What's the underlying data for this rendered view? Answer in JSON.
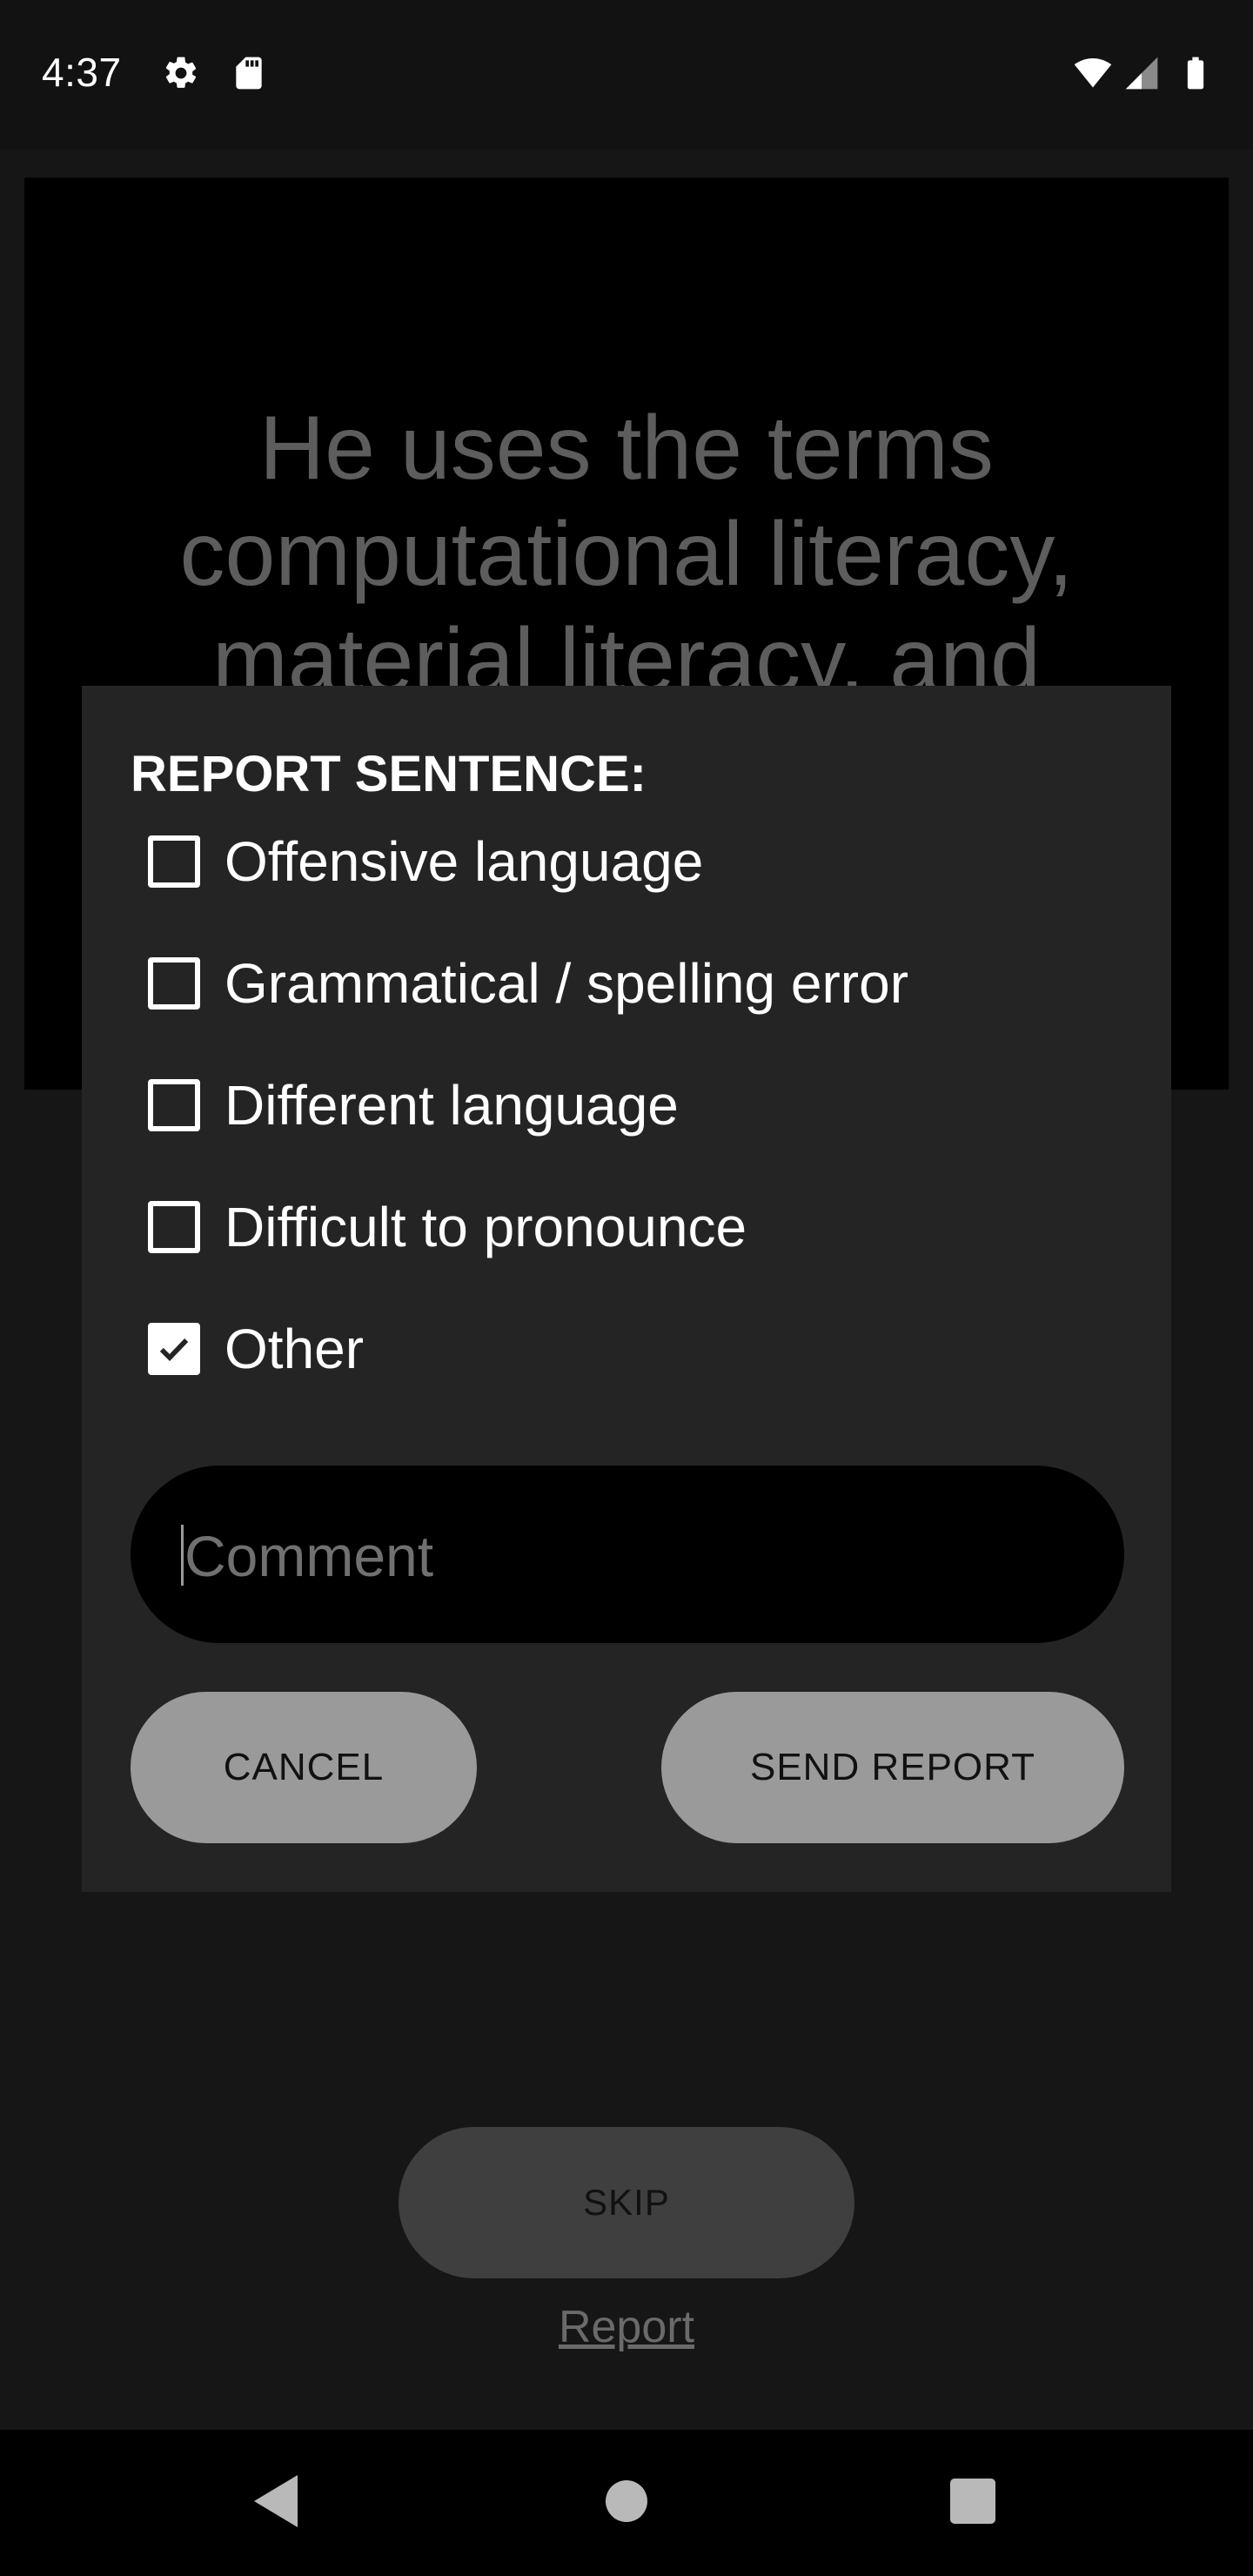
{
  "status_bar": {
    "time": "4:37",
    "left_icons": [
      "gear-icon",
      "sd-card-icon"
    ],
    "right_icons": [
      "wifi-icon",
      "cell-signal-icon",
      "battery-icon"
    ]
  },
  "sentence": {
    "text": "He uses the terms computational literacy, material literacy, and"
  },
  "dialog": {
    "title": "REPORT SENTENCE:",
    "options": [
      {
        "label": "Offensive language",
        "checked": false
      },
      {
        "label": "Grammatical / spelling error",
        "checked": false
      },
      {
        "label": "Different language",
        "checked": false
      },
      {
        "label": "Difficult to pronounce",
        "checked": false
      },
      {
        "label": "Other",
        "checked": true
      }
    ],
    "comment": {
      "placeholder": "Comment",
      "value": ""
    },
    "cancel_label": "CANCEL",
    "send_label": "SEND REPORT"
  },
  "footer": {
    "skip_label": "SKIP",
    "report_label": "Report"
  },
  "nav_bar": {
    "icons": [
      "back-icon",
      "home-icon",
      "recents-icon"
    ]
  }
}
